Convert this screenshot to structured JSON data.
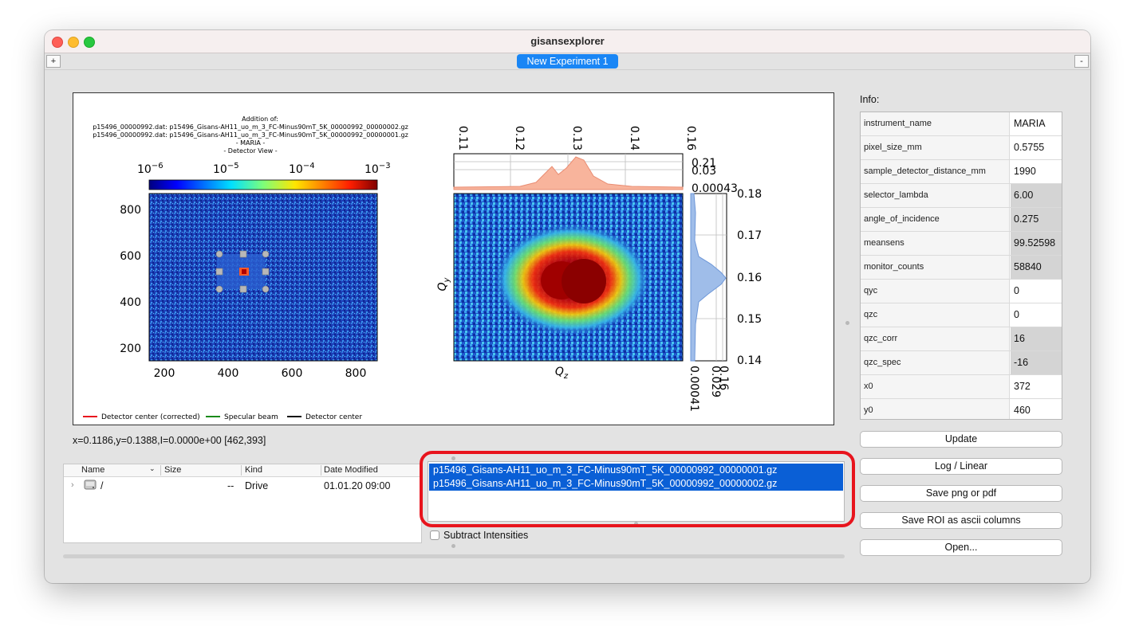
{
  "window": {
    "title": "gisansexplorer"
  },
  "tabs": {
    "add_label": "+",
    "remove_label": "-",
    "active": "New Experiment 1"
  },
  "plot": {
    "title_lines": [
      "Addition of:",
      "p15496_00000992.dat: p15496_Gisans-AH11_uo_m_3_FC-Minus90mT_5K_00000992_00000002.gz",
      "p15496_00000992.dat: p15496_Gisans-AH11_uo_m_3_FC-Minus90mT_5K_00000992_00000001.gz",
      "- MARIA -",
      "- Detector View -"
    ],
    "colorbar_ticks": [
      "10",
      "10",
      "10",
      "10"
    ],
    "colorbar_exponents": [
      "−6",
      "−5",
      "−4",
      "−3"
    ],
    "detector_xticks": [
      "200",
      "400",
      "600",
      "800"
    ],
    "detector_yticks": [
      "800",
      "600",
      "400",
      "200"
    ],
    "q_top_ticks": [
      "0.11",
      "0.12",
      "0.13",
      "0.14",
      "0.16"
    ],
    "q_top_right_ticks": [
      "0.21",
      "0.03",
      "0.00043"
    ],
    "q_right_ticks": [
      "0.18",
      "0.17",
      "0.16",
      "0.15",
      "0.14"
    ],
    "q_bottom_right_ticks": [
      "0.00041",
      "0.029",
      "0.16"
    ],
    "xlabel": "Qz",
    "ylabel": "Qy",
    "legend": [
      "Detector center (corrected)",
      "Specular beam",
      "Detector center"
    ],
    "legend_colors": [
      "#e8141d",
      "#1a8a1a",
      "#111111"
    ]
  },
  "coords_text": "x=0.1186,y=0.1388,I=0.0000e+00   [462,393]",
  "file_browser": {
    "columns": [
      "Name",
      "Size",
      "Kind",
      "Date Modified"
    ],
    "rows": [
      {
        "name": "/",
        "size": "--",
        "kind": "Drive",
        "date": "01.01.20 09:00"
      }
    ]
  },
  "file_list": [
    "p15496_Gisans-AH11_uo_m_3_FC-Minus90mT_5K_00000992_00000001.gz",
    "p15496_Gisans-AH11_uo_m_3_FC-Minus90mT_5K_00000992_00000002.gz"
  ],
  "subtract_label": "Subtract Intensities",
  "info": {
    "label": "Info:",
    "rows": [
      {
        "key": "instrument_name",
        "value": "MARIA",
        "gray": false
      },
      {
        "key": "pixel_size_mm",
        "value": "0.5755",
        "gray": false
      },
      {
        "key": "sample_detector_distance_mm",
        "value": "1990",
        "gray": false
      },
      {
        "key": "selector_lambda",
        "value": "6.00",
        "gray": true
      },
      {
        "key": "angle_of_incidence",
        "value": "0.275",
        "gray": true
      },
      {
        "key": "meansens",
        "value": "99.52598",
        "gray": true
      },
      {
        "key": "monitor_counts",
        "value": "58840",
        "gray": true
      },
      {
        "key": "qyc",
        "value": "0",
        "gray": false
      },
      {
        "key": "qzc",
        "value": "0",
        "gray": false
      },
      {
        "key": "qzc_corr",
        "value": "16",
        "gray": true
      },
      {
        "key": "qzc_spec",
        "value": "-16",
        "gray": true
      },
      {
        "key": "x0",
        "value": "372",
        "gray": false
      },
      {
        "key": "y0",
        "value": "460",
        "gray": false
      }
    ]
  },
  "buttons": {
    "update": "Update",
    "log_linear": "Log / Linear",
    "save_png": "Save png or pdf",
    "save_roi": "Save ROI as ascii columns",
    "open": "Open..."
  }
}
